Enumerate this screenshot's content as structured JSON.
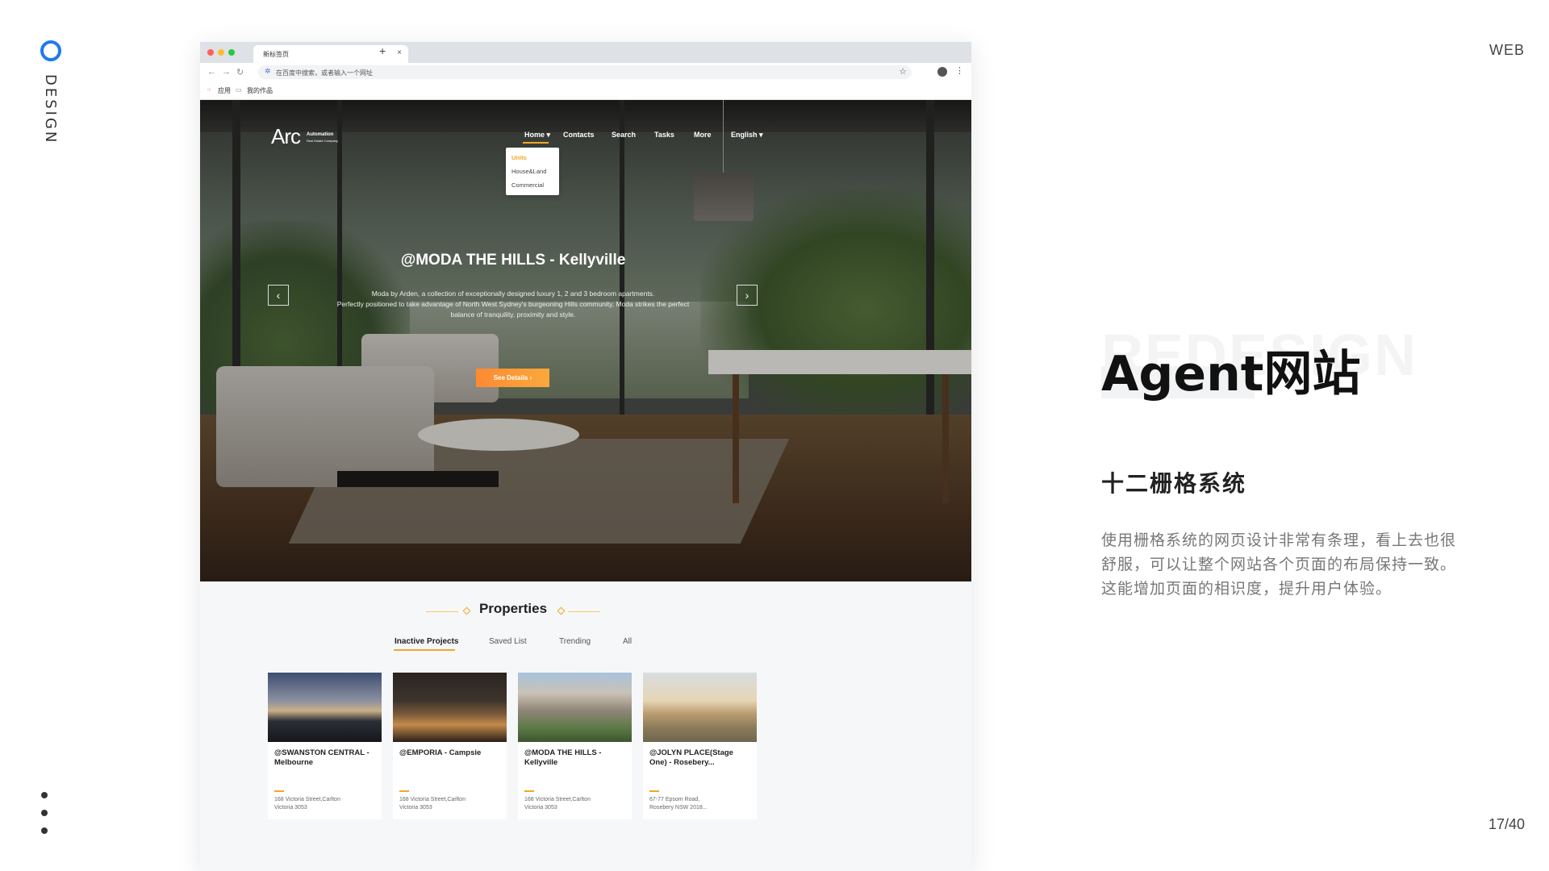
{
  "slide": {
    "rail_label": "DESIGN",
    "category": "WEB",
    "ghost_text": "REDESIGN",
    "title": "Agent网站",
    "subtitle": "十二栅格系统",
    "description": "使用栅格系统的网页设计非常有条理，看上去也很舒服，可以让整个网站各个页面的布局保持一致。这能增加页面的相识度，提升用户体验。",
    "page_number": "17/40",
    "accent_color": "#1e7bf0"
  },
  "browser": {
    "tab_title": "新标签页",
    "tab_close": "×",
    "new_tab": "+",
    "address_placeholder": "在百度中搜索，或者输入一个网址",
    "star_icon": "☆",
    "bookmarks": [
      {
        "label": "应用",
        "icon": "apps-grid-icon"
      },
      {
        "label": "我的作品",
        "icon": "folder-icon"
      }
    ]
  },
  "site": {
    "logo": "Arc",
    "logo_sub_line1": "Automation",
    "logo_sub_line2": "Real Estate Company",
    "nav": [
      "Home",
      "Contacts",
      "Search",
      "Tasks",
      "More",
      "English"
    ],
    "dropdown": [
      "Units",
      "House&Land",
      "Commercial"
    ],
    "hero_title": "@MODA THE HILLS - Kellyville",
    "hero_description_lines": [
      "Moda by Arden, a collection of exceptionally designed luxury 1, 2 and 3 bedroom apartments.",
      "Perfectly positioned to take advantage of North West Sydney's burgeoning Hills community, Moda strikes the perfect",
      "balance of tranquility, proximity and style."
    ],
    "cta_label": "See Details",
    "cta_arrow": "›",
    "accent_color": "#f5a623",
    "section_title": "Properties",
    "tabs": [
      "Inactive Projects",
      "Saved List",
      "Trending",
      "All"
    ],
    "active_tab": "Inactive Projects",
    "cards": [
      {
        "name": "@SWANSTON CENTRAL - Melbourne",
        "addr1": "168 Victoria Street,Carlton",
        "addr2": "Victoria 3053"
      },
      {
        "name": "@EMPORIA - Campsie",
        "addr1": "168 Victoria Street,Carlton",
        "addr2": "Victoria 3053"
      },
      {
        "name": "@MODA THE HILLS - Kellyville",
        "addr1": "168 Victoria Street,Carlton",
        "addr2": "Victoria 3053"
      },
      {
        "name": "@JOLYN PLACE(Stage One) - Rosebery...",
        "addr1": "67-77 Epsom Road,",
        "addr2": "Rosebery NSW 2018..."
      }
    ]
  }
}
